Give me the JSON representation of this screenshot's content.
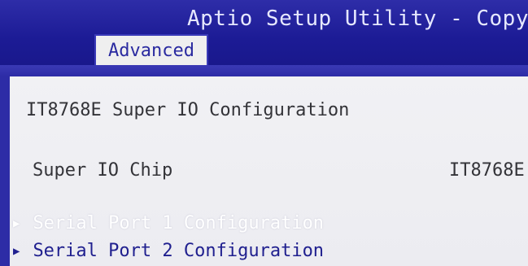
{
  "header": {
    "title": "Aptio Setup Utility - Copyrigh",
    "active_tab": "Advanced"
  },
  "main": {
    "section_title": "IT8768E Super IO Configuration",
    "super_io_chip": {
      "label": "Super IO Chip",
      "value": "IT8768E"
    },
    "menu_items": [
      {
        "label": "Serial Port 1 Configuration",
        "icon": "right-triangle-icon",
        "highlighted": true
      },
      {
        "label": "Serial Port 2 Configuration",
        "icon": "right-triangle-icon",
        "highlighted": false
      }
    ]
  },
  "colors": {
    "header_bg": "#1c1b95",
    "tab_bg": "#efefef",
    "content_bg": "#ececf0",
    "highlight_text": "#ffffff",
    "item_text": "#20208f"
  }
}
